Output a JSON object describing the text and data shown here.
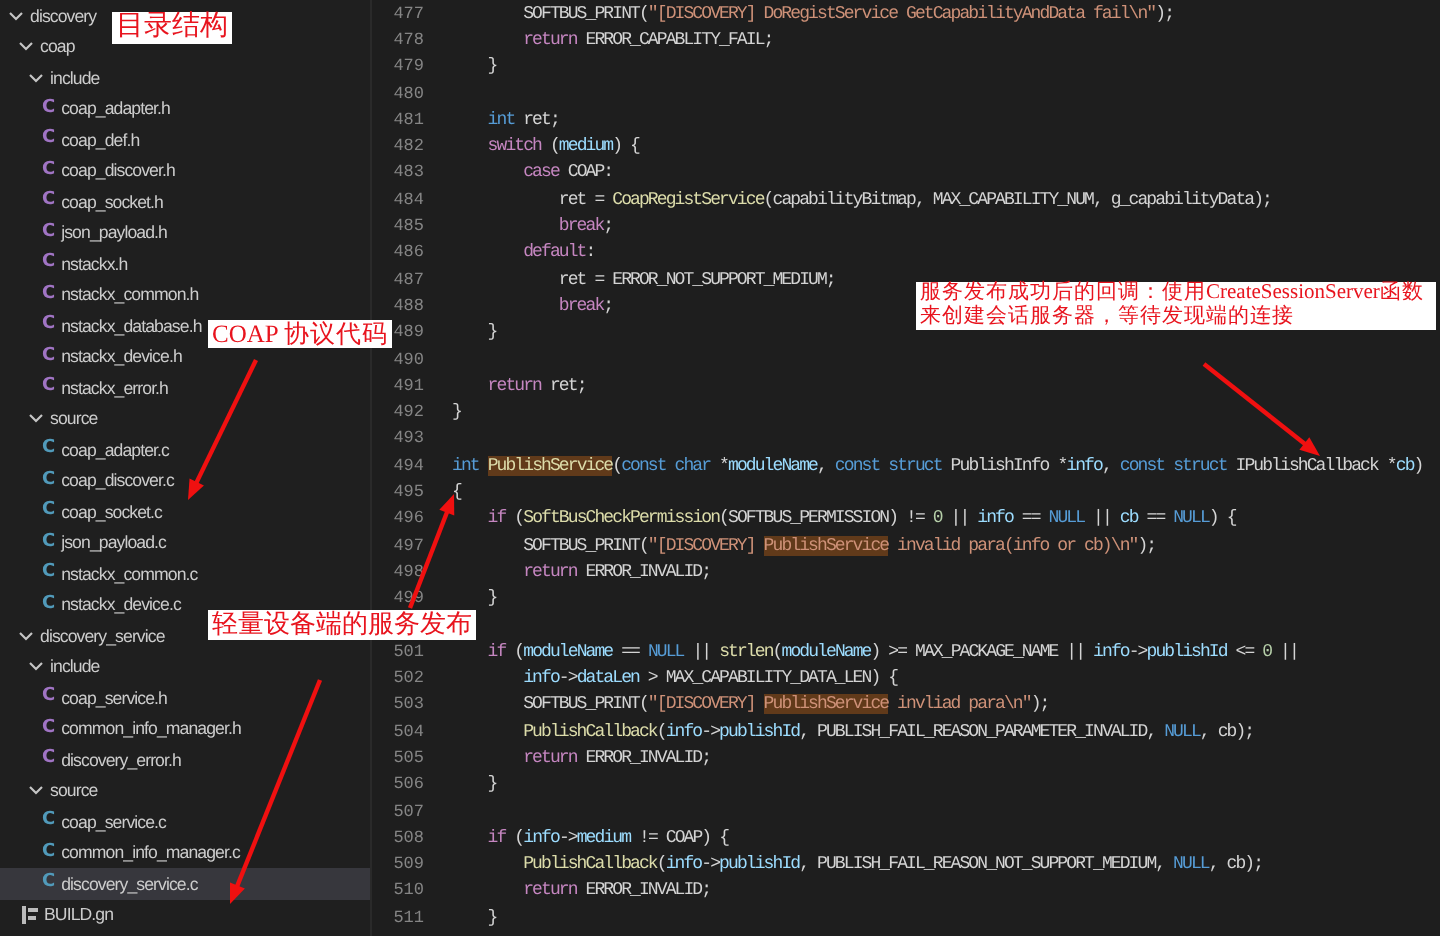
{
  "explorer": {
    "tree": [
      {
        "label": "discovery",
        "kind": "folder",
        "expanded": true,
        "selected": false,
        "children": [
          {
            "label": "coap",
            "kind": "folder",
            "expanded": true,
            "selected": false,
            "children": [
              {
                "label": "include",
                "kind": "folder",
                "expanded": true,
                "selected": false,
                "children": [
                  {
                    "label": "coap_adapter.h",
                    "kind": "c-header",
                    "icon": "C",
                    "selected": false
                  },
                  {
                    "label": "coap_def.h",
                    "kind": "c-header",
                    "icon": "C",
                    "selected": false
                  },
                  {
                    "label": "coap_discover.h",
                    "kind": "c-header",
                    "icon": "C",
                    "selected": false
                  },
                  {
                    "label": "coap_socket.h",
                    "kind": "c-header",
                    "icon": "C",
                    "selected": false
                  },
                  {
                    "label": "json_payload.h",
                    "kind": "c-header",
                    "icon": "C",
                    "selected": false
                  },
                  {
                    "label": "nstackx.h",
                    "kind": "c-header",
                    "icon": "C",
                    "selected": false
                  },
                  {
                    "label": "nstackx_common.h",
                    "kind": "c-header",
                    "icon": "C",
                    "selected": false
                  },
                  {
                    "label": "nstackx_database.h",
                    "kind": "c-header",
                    "icon": "C",
                    "selected": false
                  },
                  {
                    "label": "nstackx_device.h",
                    "kind": "c-header",
                    "icon": "C",
                    "selected": false
                  },
                  {
                    "label": "nstackx_error.h",
                    "kind": "c-header",
                    "icon": "C",
                    "selected": false
                  }
                ]
              },
              {
                "label": "source",
                "kind": "folder",
                "expanded": true,
                "selected": false,
                "children": [
                  {
                    "label": "coap_adapter.c",
                    "kind": "c-source",
                    "icon": "C",
                    "selected": false
                  },
                  {
                    "label": "coap_discover.c",
                    "kind": "c-source",
                    "icon": "C",
                    "selected": false
                  },
                  {
                    "label": "coap_socket.c",
                    "kind": "c-source",
                    "icon": "C",
                    "selected": false
                  },
                  {
                    "label": "json_payload.c",
                    "kind": "c-source",
                    "icon": "C",
                    "selected": false
                  },
                  {
                    "label": "nstackx_common.c",
                    "kind": "c-source",
                    "icon": "C",
                    "selected": false
                  },
                  {
                    "label": "nstackx_device.c",
                    "kind": "c-source",
                    "icon": "C",
                    "selected": false
                  }
                ]
              }
            ]
          },
          {
            "label": "discovery_service",
            "kind": "folder",
            "expanded": true,
            "selected": false,
            "children": [
              {
                "label": "include",
                "kind": "folder",
                "expanded": true,
                "selected": false,
                "children": [
                  {
                    "label": "coap_service.h",
                    "kind": "c-header",
                    "icon": "C",
                    "selected": false
                  },
                  {
                    "label": "common_info_manager.h",
                    "kind": "c-header",
                    "icon": "C",
                    "selected": false
                  },
                  {
                    "label": "discovery_error.h",
                    "kind": "c-header",
                    "icon": "C",
                    "selected": false
                  }
                ]
              },
              {
                "label": "source",
                "kind": "folder",
                "expanded": true,
                "selected": false,
                "children": [
                  {
                    "label": "coap_service.c",
                    "kind": "c-source",
                    "icon": "C",
                    "selected": false
                  },
                  {
                    "label": "common_info_manager.c",
                    "kind": "c-source",
                    "icon": "C",
                    "selected": false
                  },
                  {
                    "label": "discovery_service.c",
                    "kind": "c-source",
                    "icon": "C",
                    "selected": true
                  }
                ]
              }
            ]
          },
          {
            "label": "BUILD.gn",
            "kind": "build",
            "selected": false
          }
        ]
      }
    ]
  },
  "editor": {
    "lines": [
      {
        "number": "477",
        "code": [
          {
            "text": "        SOFTBUS_PRINT(",
            "kind": "plain"
          },
          {
            "text": "\"[DISCOVERY] DoRegistService GetCapabilityAndData fail\\n\"",
            "kind": "string"
          },
          {
            "text": ");",
            "kind": "plain"
          }
        ]
      },
      {
        "number": "478",
        "code": [
          {
            "text": "        return",
            "kind": "keyword"
          },
          {
            "text": " ERROR_CAPABLITY_FAIL;",
            "kind": "plain"
          }
        ]
      },
      {
        "number": "479",
        "code": [
          {
            "text": "    }",
            "kind": "plain"
          }
        ]
      },
      {
        "number": "480"
      },
      {
        "number": "481",
        "code": [
          {
            "text": "    int",
            "kind": "type"
          },
          {
            "text": " ret;",
            "kind": "plain"
          }
        ]
      },
      {
        "number": "482",
        "code": [
          {
            "text": "    switch",
            "kind": "keyword"
          },
          {
            "text": " (",
            "kind": "plain"
          },
          {
            "text": "medium",
            "kind": "variable"
          },
          {
            "text": ") {",
            "kind": "plain"
          }
        ]
      },
      {
        "number": "483",
        "code": [
          {
            "text": "        case",
            "kind": "keyword"
          },
          {
            "text": " COAP:",
            "kind": "plain"
          }
        ]
      },
      {
        "number": "484",
        "code": [
          {
            "text": "            ret = ",
            "kind": "plain"
          },
          {
            "text": "CoapRegistService",
            "kind": "function"
          },
          {
            "text": "(capabilityBitmap, MAX_CAPABILITY_NUM, g_capabilityData);",
            "kind": "plain"
          }
        ]
      },
      {
        "number": "485",
        "code": [
          {
            "text": "            break",
            "kind": "keyword"
          },
          {
            "text": ";",
            "kind": "plain"
          }
        ]
      },
      {
        "number": "486",
        "code": [
          {
            "text": "        default",
            "kind": "keyword"
          },
          {
            "text": ":",
            "kind": "plain"
          }
        ]
      },
      {
        "number": "487",
        "code": [
          {
            "text": "            ret = ERROR_NOT_SUPPORT_MEDIUM;",
            "kind": "plain"
          }
        ]
      },
      {
        "number": "488",
        "code": [
          {
            "text": "            break",
            "kind": "keyword"
          },
          {
            "text": ";",
            "kind": "plain"
          }
        ]
      },
      {
        "number": "489",
        "code": [
          {
            "text": "    }",
            "kind": "plain"
          }
        ]
      },
      {
        "number": "490"
      },
      {
        "number": "491",
        "code": [
          {
            "text": "    return",
            "kind": "keyword"
          },
          {
            "text": " ret;",
            "kind": "plain"
          }
        ]
      },
      {
        "number": "492",
        "code": [
          {
            "text": "}",
            "kind": "plain"
          }
        ]
      },
      {
        "number": "493"
      },
      {
        "number": "494",
        "code": [
          {
            "text": "int ",
            "kind": "type"
          },
          {
            "text": "PublishService",
            "kind": "function-match"
          },
          {
            "text": "(",
            "kind": "plain"
          },
          {
            "text": "const char",
            "kind": "type"
          },
          {
            "text": " *",
            "kind": "plain"
          },
          {
            "text": "moduleName",
            "kind": "variable"
          },
          {
            "text": ", ",
            "kind": "plain"
          },
          {
            "text": "const struct",
            "kind": "type"
          },
          {
            "text": " PublishInfo *",
            "kind": "plain"
          },
          {
            "text": "info",
            "kind": "variable"
          },
          {
            "text": ", ",
            "kind": "plain"
          },
          {
            "text": "const struct",
            "kind": "type"
          },
          {
            "text": " IPublishCallback *",
            "kind": "plain"
          },
          {
            "text": "cb",
            "kind": "variable"
          },
          {
            "text": ")",
            "kind": "plain"
          }
        ]
      },
      {
        "number": "495",
        "code": [
          {
            "text": "{",
            "kind": "plain"
          }
        ]
      },
      {
        "number": "496",
        "code": [
          {
            "text": "    if",
            "kind": "keyword"
          },
          {
            "text": " (",
            "kind": "plain"
          },
          {
            "text": "SoftBusCheckPermission",
            "kind": "function"
          },
          {
            "text": "(SOFTBUS_PERMISSION) != ",
            "kind": "plain"
          },
          {
            "text": "0",
            "kind": "number"
          },
          {
            "text": " || ",
            "kind": "plain"
          },
          {
            "text": "info",
            "kind": "variable"
          },
          {
            "text": " == ",
            "kind": "plain"
          },
          {
            "text": "NULL",
            "kind": "type"
          },
          {
            "text": " || ",
            "kind": "plain"
          },
          {
            "text": "cb",
            "kind": "variable"
          },
          {
            "text": " == ",
            "kind": "plain"
          },
          {
            "text": "NULL",
            "kind": "type"
          },
          {
            "text": ") {",
            "kind": "plain"
          }
        ]
      },
      {
        "number": "497",
        "code": [
          {
            "text": "        SOFTBUS_PRINT(",
            "kind": "plain"
          },
          {
            "text": "\"[DISCOVERY] ",
            "kind": "string"
          },
          {
            "text": "PublishService",
            "kind": "string-match"
          },
          {
            "text": " invalid para(info or cb)\\n\"",
            "kind": "string"
          },
          {
            "text": ");",
            "kind": "plain"
          }
        ]
      },
      {
        "number": "498",
        "code": [
          {
            "text": "        return",
            "kind": "keyword"
          },
          {
            "text": " ERROR_INVALID;",
            "kind": "plain"
          }
        ]
      },
      {
        "number": "499",
        "code": [
          {
            "text": "    }",
            "kind": "plain"
          }
        ]
      },
      {
        "number": "501",
        "code": [
          {
            "text": "    if",
            "kind": "keyword"
          },
          {
            "text": " (",
            "kind": "plain"
          },
          {
            "text": "moduleName",
            "kind": "variable"
          },
          {
            "text": " == ",
            "kind": "plain"
          },
          {
            "text": "NULL",
            "kind": "type"
          },
          {
            "text": " || ",
            "kind": "plain"
          },
          {
            "text": "strlen",
            "kind": "function"
          },
          {
            "text": "(",
            "kind": "plain"
          },
          {
            "text": "moduleName",
            "kind": "variable"
          },
          {
            "text": ") >= MAX_PACKAGE_NAME || ",
            "kind": "plain"
          },
          {
            "text": "info",
            "kind": "variable"
          },
          {
            "text": "->",
            "kind": "plain"
          },
          {
            "text": "publishId",
            "kind": "variable"
          },
          {
            "text": " <= ",
            "kind": "plain"
          },
          {
            "text": "0",
            "kind": "number"
          },
          {
            "text": " ||",
            "kind": "plain"
          }
        ]
      },
      {
        "number": "502",
        "code": [
          {
            "text": "        info",
            "kind": "variable"
          },
          {
            "text": "->",
            "kind": "plain"
          },
          {
            "text": "dataLen",
            "kind": "variable"
          },
          {
            "text": " > MAX_CAPABILITY_DATA_LEN) {",
            "kind": "plain"
          }
        ]
      },
      {
        "number": "503",
        "code": [
          {
            "text": "        SOFTBUS_PRINT(",
            "kind": "plain"
          },
          {
            "text": "\"[DISCOVERY] ",
            "kind": "string"
          },
          {
            "text": "PublishService",
            "kind": "string-match"
          },
          {
            "text": " invliad para\\n\"",
            "kind": "string"
          },
          {
            "text": ");",
            "kind": "plain"
          }
        ]
      },
      {
        "number": "504",
        "code": [
          {
            "text": "        PublishCallback",
            "kind": "function"
          },
          {
            "text": "(",
            "kind": "plain"
          },
          {
            "text": "info",
            "kind": "variable"
          },
          {
            "text": "->",
            "kind": "plain"
          },
          {
            "text": "publishId",
            "kind": "variable"
          },
          {
            "text": ", PUBLISH_FAIL_REASON_PARAMETER_INVALID, ",
            "kind": "plain"
          },
          {
            "text": "NULL",
            "kind": "type"
          },
          {
            "text": ", cb);",
            "kind": "plain"
          }
        ]
      },
      {
        "number": "505",
        "code": [
          {
            "text": "        return",
            "kind": "keyword"
          },
          {
            "text": " ERROR_INVALID;",
            "kind": "plain"
          }
        ]
      },
      {
        "number": "506",
        "code": [
          {
            "text": "    }",
            "kind": "plain"
          }
        ]
      },
      {
        "number": "507"
      },
      {
        "number": "508",
        "code": [
          {
            "text": "    if",
            "kind": "keyword"
          },
          {
            "text": " (",
            "kind": "plain"
          },
          {
            "text": "info",
            "kind": "variable"
          },
          {
            "text": "->",
            "kind": "plain"
          },
          {
            "text": "medium",
            "kind": "variable"
          },
          {
            "text": " != COAP) {",
            "kind": "plain"
          }
        ]
      },
      {
        "number": "509",
        "code": [
          {
            "text": "        PublishCallback",
            "kind": "function"
          },
          {
            "text": "(",
            "kind": "plain"
          },
          {
            "text": "info",
            "kind": "variable"
          },
          {
            "text": "->",
            "kind": "plain"
          },
          {
            "text": "publishId",
            "kind": "variable"
          },
          {
            "text": ", PUBLISH_FAIL_REASON_NOT_SUPPORT_MEDIUM, ",
            "kind": "plain"
          },
          {
            "text": "NULL",
            "kind": "type"
          },
          {
            "text": ", cb);",
            "kind": "plain"
          }
        ]
      },
      {
        "number": "510",
        "code": [
          {
            "text": "        return",
            "kind": "keyword"
          },
          {
            "text": " ERROR_INVALID;",
            "kind": "plain"
          }
        ]
      },
      {
        "number": "511",
        "code": [
          {
            "text": "    }",
            "kind": "plain"
          }
        ]
      }
    ]
  },
  "annotations": [
    {
      "text": "目录结构"
    },
    {
      "text": "COAP 协议代码"
    },
    {
      "text": "轻量设备端的服务发布"
    },
    {
      "text": "服务发布成功后的回调：使用CreateSessionServer函数来创建会话服务器，等待发现端的连接"
    }
  ]
}
